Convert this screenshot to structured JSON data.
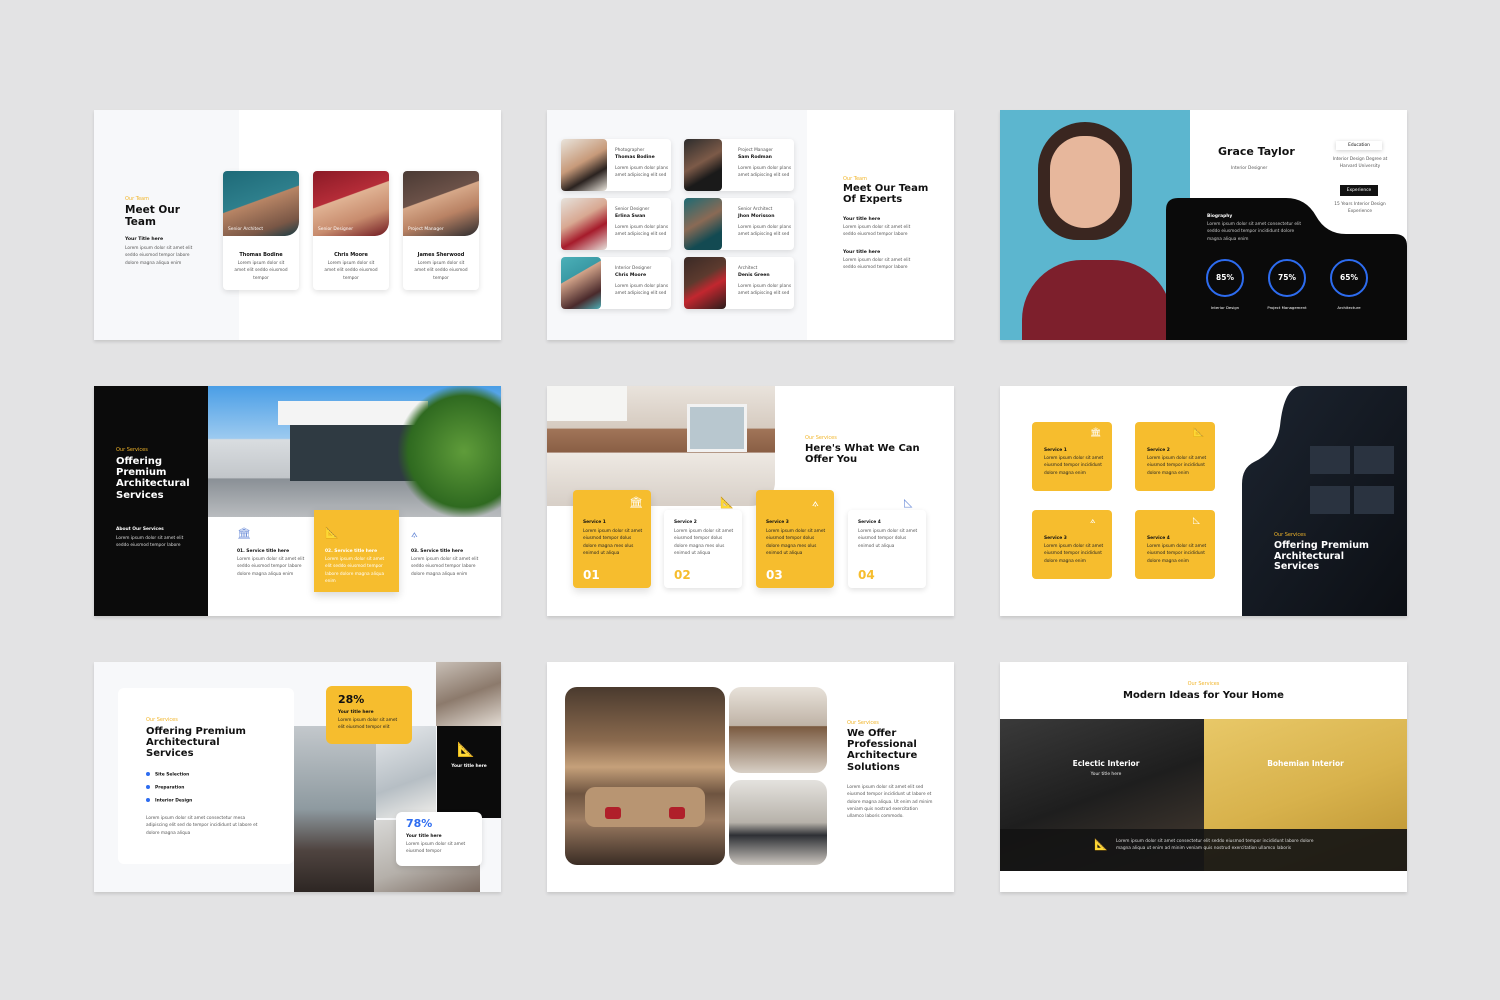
{
  "s1": {
    "eyebrow": "Our Team",
    "title": "Meet Our Team",
    "sub": "Your Title here",
    "text": "Lorem ipsum dolor sit amet elit seddo eiusmod tempor labore dolore magna aliqua enim",
    "members": [
      {
        "role": "Senior Architect",
        "name": "Thomas Bodine",
        "text": "Lorem ipsum dolor sit amet elit seddo eiusmod tempor"
      },
      {
        "role": "Senior Designer",
        "name": "Chris Moore",
        "text": "Lorem ipsum dolor sit amet elit seddo eiusmod tempor"
      },
      {
        "role": "Project Manager",
        "name": "James Sherwood",
        "text": "Lorem ipsum dolor sit amet elit seddo eiusmod tempor"
      }
    ]
  },
  "s2": {
    "eyebrow": "Our Team",
    "title": "Meet Our Team Of Experts",
    "sub1": "Your title here",
    "text1": "Lorem ipsum dolor sit amet elit seddo eiusmod tempor labore",
    "sub2": "Your title here",
    "text2": "Lorem ipsum dolor sit amet elit seddo eiusmod tempor labore",
    "people": [
      {
        "role": "Photographer",
        "name": "Thomas Bodine",
        "text": "Lorem ipsum dolor plans amet adipiscing elit sed"
      },
      {
        "role": "Project Manager",
        "name": "Sam Rodman",
        "text": "Lorem ipsum dolor plans amet adipiscing elit sed"
      },
      {
        "role": "Senior Designer",
        "name": "Erlina Swan",
        "text": "Lorem ipsum dolor plans amet adipiscing elit sed"
      },
      {
        "role": "Senior Architect",
        "name": "Jhon Morisson",
        "text": "Lorem ipsum dolor plans amet adipiscing elit sed"
      },
      {
        "role": "Interior Designer",
        "name": "Chris Moore",
        "text": "Lorem ipsum dolor plans amet adipiscing elit sed"
      },
      {
        "role": "Architect",
        "name": "Denis Green",
        "text": "Lorem ipsum dolor plans amet adipiscing elit sed"
      }
    ]
  },
  "s3": {
    "name": "Grace Taylor",
    "role": "Interior Designer",
    "edu_label": "Education",
    "edu_text": "Interior Design Degree at Harvard University",
    "exp_label": "Experience",
    "exp_text": "15 Years Interior Design Experience",
    "bio_label": "Biography",
    "bio_text": "Lorem ipsum dolor sit amet consectetur elit seddo eiusmod tempor incididunt dolore magna aliqua enim",
    "skills": [
      {
        "value": "85%",
        "label": "Interior Design"
      },
      {
        "value": "75%",
        "label": "Project Management"
      },
      {
        "value": "65%",
        "label": "Architecture"
      }
    ]
  },
  "s4": {
    "eyebrow": "Our Services",
    "title": "Offering Premium Architectural Services",
    "about": "About Our Services",
    "about_text": "Lorem ipsum dolor sit amet elit seddo eiusmod tempor labore",
    "items": [
      {
        "title": "01. Service title here",
        "text": "Lorem ipsum dolor sit amet elit seddo eiusmod tempor labore dolore magna aliqua enim"
      },
      {
        "title": "02. Service title here",
        "text": "Lorem ipsum dolor sit amet elit seddo eiusmod tempor labore dolore magna aliqua enim"
      },
      {
        "title": "03. Service title here",
        "text": "Lorem ipsum dolor sit amet elit seddo eiusmod tempor labore dolore magna aliqua enim"
      }
    ]
  },
  "s5": {
    "eyebrow": "Our Services",
    "title": "Here's What We Can Offer You",
    "cards": [
      {
        "title": "Service 1",
        "text": "Lorem ipsum dolor sit amet eiusmod tempor dolus dolore magna mes olus enimod ut aliqua",
        "num": "01"
      },
      {
        "title": "Service 2",
        "text": "Lorem ipsum dolor sit amet eiusmod tempor dolus dolore magna mes olus enimod ut aliqua",
        "num": "02"
      },
      {
        "title": "Service 3",
        "text": "Lorem ipsum dolor sit amet eiusmod tempor dolus dolore magna mes olus enimod ut aliqua",
        "num": "03"
      },
      {
        "title": "Service 4",
        "text": "Lorem ipsum dolor sit amet eiusmod tempor dolus enimod ut aliqua",
        "num": "04"
      }
    ]
  },
  "s6": {
    "eyebrow": "Our Services",
    "title": "Offering Premium Architectural Services",
    "cards": [
      {
        "title": "Service 1",
        "text": "Lorem ipsum dolor sit amet eiusmod tempor incididunt dolore magna enim"
      },
      {
        "title": "Service 2",
        "text": "Lorem ipsum dolor sit amet eiusmod tempor incididunt dolore magna enim"
      },
      {
        "title": "Service 3",
        "text": "Lorem ipsum dolor sit amet eiusmod tempor incididunt dolore magna enim"
      },
      {
        "title": "Service 4",
        "text": "Lorem ipsum dolor sit amet eiusmod tempor incididunt dolore magna enim"
      }
    ]
  },
  "s7": {
    "eyebrow": "Our Services",
    "title": "Offering Premium Architectural Services",
    "bullets": [
      "Site Selection",
      "Preparation",
      "Interior Design"
    ],
    "text": "Lorem ipsum dolor sit amet consectetur mesa adipiscing elit sed do tempor incididunt ut labore et dolore magna aliqua",
    "stat1": {
      "value": "28%",
      "title": "Your title here",
      "text": "Lorem ipsum dolor sit amet elit eiusmod tempor elit"
    },
    "stat2": {
      "value": "78%",
      "title": "Your title here",
      "text": "Lorem ipsum dolor sit amet eiusmod tempor"
    },
    "dark_label": "Your title here"
  },
  "s8": {
    "eyebrow": "Our Services",
    "title": "We Offer Professional Architecture Solutions",
    "text": "Lorem ipsum dolor sit amet elit sed eiusmod tempor incididunt ut labore et dolore magna aliqua. Ut enim ad minim veniam quis nostrud exercitation ullamco laboris commodo."
  },
  "s9": {
    "eyebrow": "Our Services",
    "title": "Modern Ideas for Your Home",
    "left": "Eclectic Interior",
    "left_sub": "Your title here",
    "right": "Bohemian Interior",
    "footer": "Lorem ipsum dolor sit amet consectetur elit seddo eiusmod tempor incididunt labore dolore magna aliqua ut enim ad minim veniam quis nostrud exercitation ullamco laboris"
  }
}
